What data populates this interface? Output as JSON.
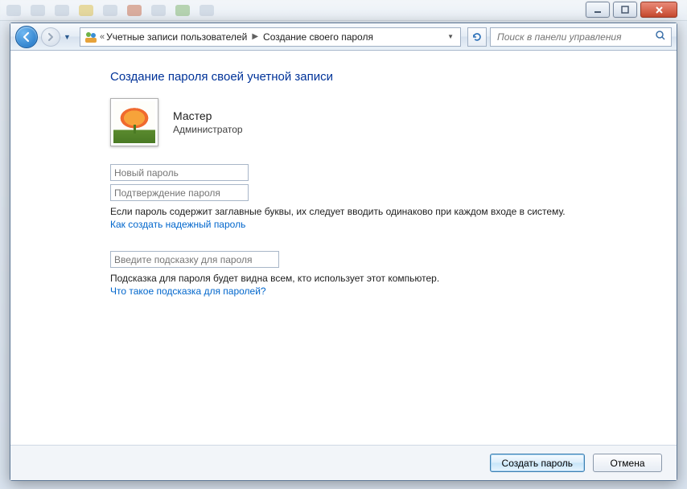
{
  "caption": {
    "minimize_tip": "Свернуть",
    "maximize_tip": "Развернуть",
    "close_tip": "Закрыть"
  },
  "toolbar": {
    "back_tip": "Назад",
    "forward_tip": "Вперёд",
    "refresh_tip": "Обновить"
  },
  "breadcrumb": {
    "segment1": "Учетные записи пользователей",
    "segment2": "Создание своего пароля"
  },
  "search": {
    "placeholder": "Поиск в панели управления"
  },
  "page": {
    "heading": "Создание пароля своей учетной записи",
    "user_name": "Мастер",
    "user_role": "Администратор",
    "new_password_ph": "Новый пароль",
    "confirm_password_ph": "Подтверждение пароля",
    "caps_note": "Если пароль содержит заглавные буквы, их следует вводить одинаково при каждом входе в систему.",
    "strong_link": "Как создать надежный пароль",
    "hint_ph": "Введите подсказку для пароля",
    "hint_note": "Подсказка для пароля будет видна всем, кто использует этот компьютер.",
    "hint_link": "Что такое подсказка для паролей?",
    "create_btn": "Создать пароль",
    "cancel_btn": "Отмена"
  }
}
